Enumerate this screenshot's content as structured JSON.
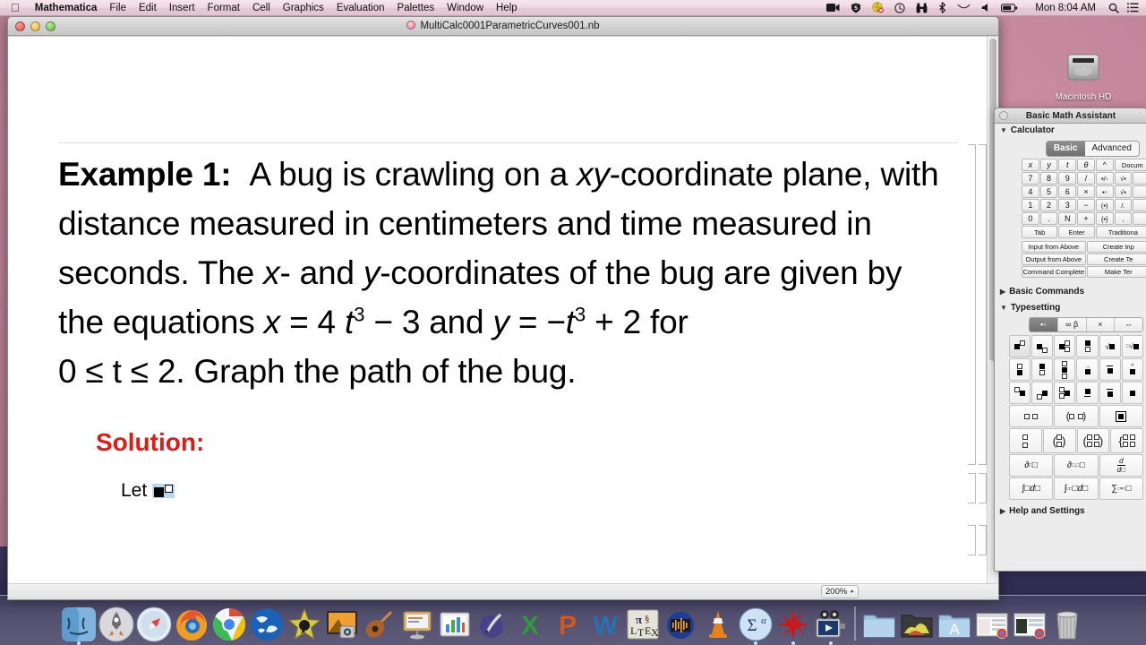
{
  "menubar": {
    "apple_icon": "apple-icon",
    "items": [
      {
        "label": "Mathematica",
        "bold": true
      },
      {
        "label": "File"
      },
      {
        "label": "Edit"
      },
      {
        "label": "Insert"
      },
      {
        "label": "Format"
      },
      {
        "label": "Cell"
      },
      {
        "label": "Graphics"
      },
      {
        "label": "Evaluation"
      },
      {
        "label": "Palettes"
      },
      {
        "label": "Window"
      },
      {
        "label": "Help"
      }
    ],
    "tray": [
      {
        "name": "screen-recording-icon"
      },
      {
        "name": "shield-5-icon"
      },
      {
        "name": "globe-icon"
      },
      {
        "name": "time-machine-icon"
      },
      {
        "name": "binoculars-icon"
      },
      {
        "name": "bluetooth-icon"
      },
      {
        "name": "wifi-icon"
      },
      {
        "name": "volume-icon"
      },
      {
        "name": "battery-icon"
      }
    ],
    "clock": "Mon 8:04 AM",
    "search_icon": "spotlight-search-icon",
    "notification_icon": "notification-center-icon"
  },
  "desktop": {
    "hd_icon_label": "Macintosh HD"
  },
  "notebook": {
    "title": "MultiCalc0001ParametricCurves001.nb",
    "zoom": "200%",
    "zoom_arrow": "▸",
    "content": {
      "example_label": "Example 1:",
      "body_line1": "A bug is crawling on a ",
      "body_xy": "xy",
      "body_line2": "-coordinate plane, with distance measured in centimeters and time measured in seconds.  The ",
      "body_x": "x",
      "body_dash1": "- and ",
      "body_y": "y",
      "body_line3": "-coordinates of the bug are given by the equations ",
      "eq_x_var": "x",
      "eq_x_body": " = 4 ",
      "eq_t1": "t",
      "eq_pow1": "3",
      "eq_minus3": " − 3 and ",
      "eq_y_var": "y",
      "eq_y_body": " = −",
      "eq_t2": "t",
      "eq_pow2": "3",
      "eq_plus2": " + 2 for",
      "range": "0 ≤ t ≤ 2.",
      "tail": "  Graph the path of the bug.",
      "solution_label": "Solution:",
      "let_label": "Let",
      "let_placeholder": "superscript-placeholder-selected"
    }
  },
  "palette": {
    "title": "Basic Math Assistant",
    "sections": [
      {
        "name": "Calculator",
        "expanded": true,
        "tri": "▼"
      },
      {
        "name": "Basic Commands",
        "expanded": false,
        "tri": "▶"
      },
      {
        "name": "Typesetting",
        "expanded": true,
        "tri": "▼"
      },
      {
        "name": "Help and Settings",
        "expanded": false,
        "tri": "▶"
      }
    ],
    "calc_tabs": [
      {
        "label": "Basic",
        "selected": true
      },
      {
        "label": "Advanced",
        "selected": false
      }
    ],
    "calc_keys": [
      [
        "x",
        "y",
        "t",
        "θ",
        "^",
        "Docum"
      ],
      [
        "7",
        "8",
        "9",
        "/",
        "▪/▫",
        "√▪"
      ],
      [
        "4",
        "5",
        "6",
        "×",
        "▪▫",
        "√▪"
      ],
      [
        "1",
        "2",
        "3",
        "−",
        "(▪)",
        "/."
      ],
      [
        "0",
        ".",
        "N",
        "+",
        "{▪}",
        ","
      ]
    ],
    "calc_bottom_row": [
      "Tab",
      "Enter",
      "Traditiona"
    ],
    "calc_func_keys": [
      [
        "Input from Above",
        "Create Inp"
      ],
      [
        "Output from Above",
        "Create Te"
      ],
      [
        "Command Complete",
        "Make Ter"
      ]
    ],
    "typeset_tabs": [
      {
        "label": "▪▫",
        "name": "subsuperscript-tab",
        "selected": true
      },
      {
        "label": "∞ β",
        "name": "symbols-tab",
        "selected": false
      },
      {
        "label": "×",
        "name": "operators-tab",
        "selected": false
      },
      {
        "label": "⇔",
        "name": "arrows-tab",
        "selected": false
      }
    ],
    "typeset_rows": [
      [
        "superscript",
        "subscript",
        "subsuperscript",
        "over-under",
        "sqrt",
        "nth-root"
      ],
      [
        "above-left",
        "above",
        "above-stack",
        "vector",
        "bar",
        "hat"
      ],
      [
        "presuperscript",
        "presubscript",
        "presubsuperscript",
        "underline",
        "overline",
        "dot"
      ],
      [
        "grid-2",
        "parens-2",
        "matrix-frame"
      ],
      [
        "column-2",
        "column-paren",
        "matrix-2x2",
        "piecewise"
      ],
      [
        "partial-derivative",
        "partial-multi",
        "total-derivative"
      ],
      [
        "indefinite-integral",
        "definite-integral",
        "sum"
      ]
    ]
  },
  "dock": {
    "items": [
      {
        "name": "finder",
        "running": true
      },
      {
        "name": "launchpad",
        "running": false
      },
      {
        "name": "safari",
        "running": false
      },
      {
        "name": "firefox",
        "running": false
      },
      {
        "name": "chrome",
        "running": false
      },
      {
        "name": "google-earth",
        "running": false
      },
      {
        "name": "imovie",
        "running": false
      },
      {
        "name": "iphoto",
        "running": false
      },
      {
        "name": "garageband",
        "running": false
      },
      {
        "name": "keynote",
        "running": false
      },
      {
        "name": "numbers",
        "running": false
      },
      {
        "name": "pages",
        "running": false
      },
      {
        "name": "excel",
        "running": false
      },
      {
        "name": "powerpoint",
        "running": false
      },
      {
        "name": "word",
        "running": false
      },
      {
        "name": "latex",
        "running": false
      },
      {
        "name": "audacity",
        "running": false
      },
      {
        "name": "vlc",
        "running": false
      },
      {
        "name": "mathtype",
        "running": true
      },
      {
        "name": "mathematica",
        "running": true
      },
      {
        "name": "quicktime",
        "running": true
      },
      {
        "name": "folder-documents",
        "running": false
      },
      {
        "name": "folder-downloads",
        "running": false
      },
      {
        "name": "applications-folder",
        "running": false
      },
      {
        "name": "window-thumb-1",
        "running": false
      },
      {
        "name": "window-thumb-2",
        "running": false
      },
      {
        "name": "trash",
        "running": false
      }
    ]
  },
  "colors": {
    "solution_red": "#e11b14",
    "menubar_pink": "#efd9e2",
    "selection_blue": "#bcd6ef"
  }
}
